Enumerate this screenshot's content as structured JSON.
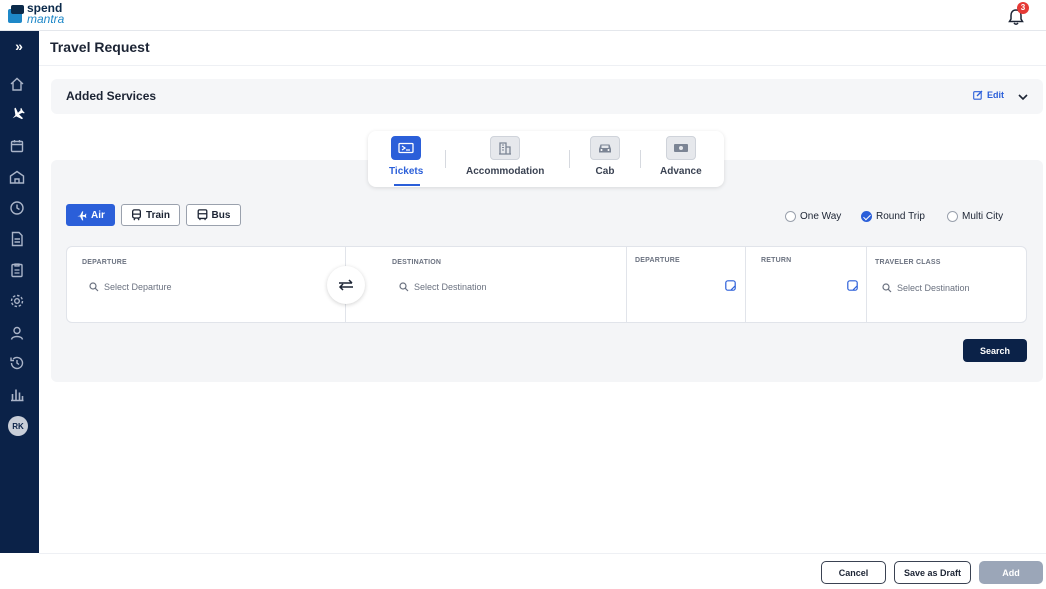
{
  "brand": {
    "line1": "spend",
    "line2": "mantra"
  },
  "notifications": {
    "count": "3"
  },
  "sidebar": {
    "expand_glyph": "»",
    "items": [
      "home-icon",
      "flight-icon",
      "calendar-icon",
      "building-icon",
      "clock-icon",
      "document-icon",
      "clipboard-icon",
      "settings-icon",
      "user-icon",
      "history-icon",
      "chart-icon"
    ],
    "avatar": "RK"
  },
  "page": {
    "title": "Travel Request"
  },
  "added_services": {
    "label": "Added Services",
    "edit_label": "Edit"
  },
  "service_tabs": [
    {
      "label": "Tickets",
      "icon": "ticket-icon",
      "active": true
    },
    {
      "label": "Accommodation",
      "icon": "building-icon",
      "active": false
    },
    {
      "label": "Cab",
      "icon": "car-icon",
      "active": false
    },
    {
      "label": "Advance",
      "icon": "cash-icon",
      "active": false
    }
  ],
  "modes": [
    {
      "label": "Air",
      "active": true
    },
    {
      "label": "Train",
      "active": false
    },
    {
      "label": "Bus",
      "active": false
    }
  ],
  "trip_types": [
    {
      "label": "One Way",
      "selected": false
    },
    {
      "label": "Round Trip",
      "selected": true
    },
    {
      "label": "Multi City",
      "selected": false
    }
  ],
  "search_form": {
    "departure_label": "DEPARTURE",
    "departure_placeholder": "Select Departure",
    "destination_label": "DESTINATION",
    "destination_placeholder": "Select Destination",
    "depart_date_label": "DEPARTURE",
    "return_date_label": "RETURN",
    "class_label": "TRAVELER CLASS",
    "class_placeholder": "Select Destination",
    "search_button": "Search"
  },
  "footer": {
    "cancel": "Cancel",
    "save_draft": "Save as Draft",
    "add": "Add"
  },
  "colors": {
    "accent": "#2b5fd9",
    "navy": "#0b2248",
    "panel": "#f4f5f7",
    "badge": "#e53935"
  }
}
